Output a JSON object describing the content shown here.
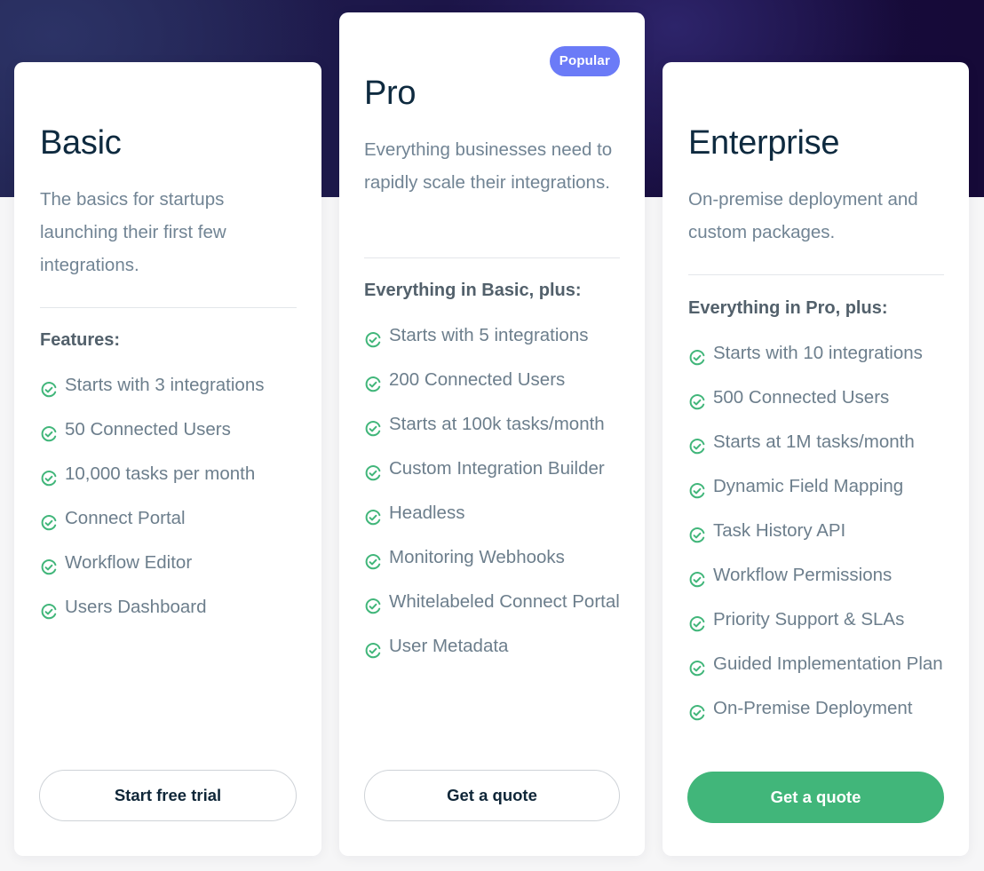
{
  "colors": {
    "accent_green": "#41b67a",
    "badge_blue": "#6b7bf7",
    "heading": "#0e2a3f",
    "body_text": "#6c7e8c",
    "hero_bg": "#1c1548"
  },
  "plans": [
    {
      "name": "Basic",
      "description": "The basics for startups launching their first few integrations.",
      "list_heading": "Features:",
      "features": [
        "Starts with 3 integrations",
        "50 Connected Users",
        "10,000 tasks per month",
        "Connect Portal",
        "Workflow Editor",
        "Users Dashboard"
      ],
      "cta_label": "Start free trial",
      "cta_style": "outline",
      "icon": "check-circle-icon"
    },
    {
      "name": "Pro",
      "badge": "Popular",
      "description": "Everything businesses need to rapidly scale their integrations.",
      "list_heading": "Everything in Basic, plus:",
      "features": [
        "Starts with 5 integrations",
        "200 Connected Users",
        "Starts at 100k tasks/month",
        "Custom Integration Builder",
        "Headless",
        "Monitoring Webhooks",
        "Whitelabeled Connect Portal",
        "User Metadata"
      ],
      "cta_label": "Get a quote",
      "cta_style": "outline",
      "icon": "check-circle-icon"
    },
    {
      "name": "Enterprise",
      "description": "On-premise deployment and custom packages.",
      "list_heading": "Everything in Pro, plus:",
      "features": [
        "Starts with 10 integrations",
        "500 Connected Users",
        "Starts at 1M tasks/month",
        "Dynamic Field Mapping",
        "Task History API",
        "Workflow Permissions",
        "Priority Support & SLAs",
        "Guided Implementation Plan",
        "On-Premise Deployment"
      ],
      "cta_label": "Get a quote",
      "cta_style": "solid",
      "icon": "check-circle-icon"
    }
  ]
}
